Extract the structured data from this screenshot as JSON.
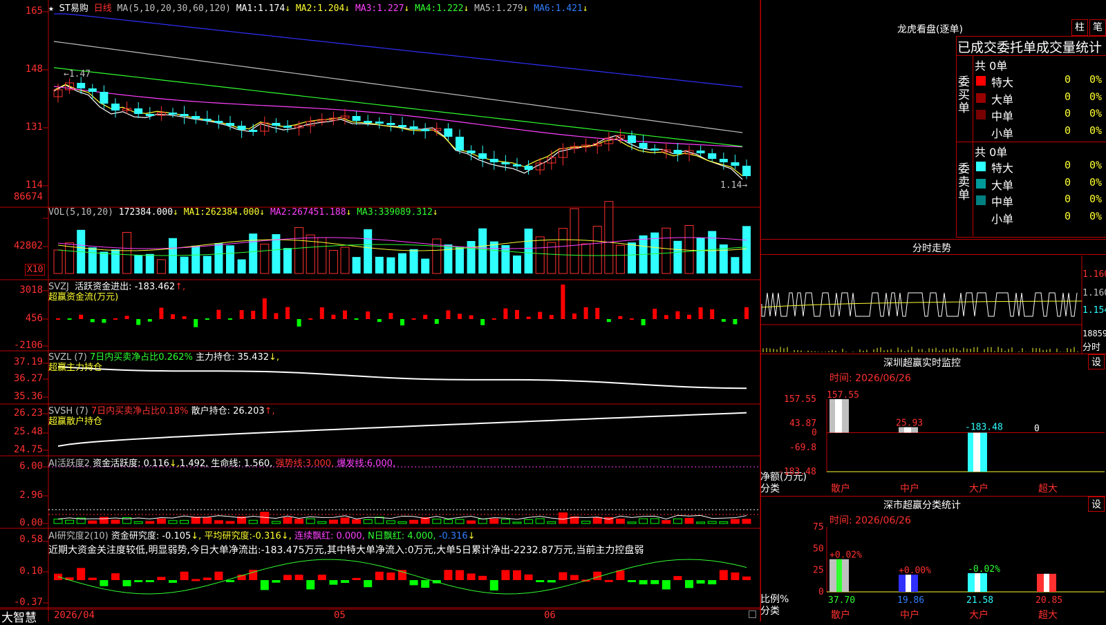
{
  "colors": {
    "up": "#ff3030",
    "down": "#30ffff",
    "grid": "#c00000",
    "ma1": "#ffffff",
    "ma2": "#ffff30",
    "ma3": "#ff40ff",
    "ma4": "#30ff30",
    "ma5": "#c0c0c0",
    "ma6": "#3030ff"
  },
  "price": {
    "title": "ST易购",
    "period": "日线",
    "ma_params": "MA(5,10,20,30,60,120)",
    "mas": [
      {
        "label": "MA1:",
        "value": "1.174",
        "arrow": "↓"
      },
      {
        "label": "MA2:",
        "value": "1.204",
        "arrow": "↓"
      },
      {
        "label": "MA3:",
        "value": "1.227",
        "arrow": "↓"
      },
      {
        "label": "MA4:",
        "value": "1.222",
        "arrow": "↓"
      },
      {
        "label": "MA5:",
        "value": "1.279",
        "arrow": "↓"
      },
      {
        "label": "MA6:",
        "value": "1.421",
        "arrow": "↓"
      }
    ],
    "axis": [
      "165",
      "148",
      "131",
      "114"
    ],
    "hi_label": "←1.47",
    "lo_label": "1.14→"
  },
  "volume": {
    "title": "VOL(5,10,20)",
    "value": "172384.000",
    "arrow": "↓",
    "mas": [
      {
        "label": "MA1:",
        "value": "262384.000",
        "arrow": "↓"
      },
      {
        "label": "MA2:",
        "value": "267451.188",
        "arrow": "↓"
      },
      {
        "label": "MA3:",
        "value": "339089.312",
        "arrow": "↓"
      }
    ],
    "axis": [
      "86674",
      "42802"
    ],
    "unit": "X10"
  },
  "svzj": {
    "title": "SVZJ",
    "text": "活跃资金进出:",
    "value": "-183.462",
    "arrow": "↑,",
    "sub": "超赢资金流(万元)",
    "axis": [
      "3018",
      "456",
      "-2106"
    ]
  },
  "svzl": {
    "title": "SVZL (7)",
    "t2": "7日内买卖净占比0.262%",
    "t3": "主力持仓:",
    "value": "35.432",
    "arrow": "↓,",
    "sub": "超赢主力持仓",
    "axis": [
      "37.19",
      "36.27",
      "35.36"
    ]
  },
  "svsh": {
    "title": "SVSH (7)",
    "t2": "7日内买卖净占比0.18%",
    "t3": "散户持仓:",
    "value": "26.203",
    "arrow": "↑,",
    "sub": "超赢散户持仓",
    "axis": [
      "26.23",
      "25.48",
      "24.75"
    ]
  },
  "ai1": {
    "title": "AI活跃度2",
    "t1": "资金活跃度:",
    "v1": "0.116",
    "a1": "↓,",
    "v2": "1.492,",
    "t3": "生命线:",
    "v3": "1.560,",
    "t4": "强势线:",
    "v4": "3.000,",
    "t5": "爆发线:",
    "v5": "6.000,",
    "axis": [
      "6.00",
      "2.96",
      "0.00"
    ]
  },
  "ai2": {
    "title": "AI研究度2(10)",
    "t1": "资金研究度:",
    "v1": "-0.105",
    "a1": "↓,",
    "t2": "平均研究度:",
    "v2": "-0.316",
    "a2": "↓,",
    "t3": "连续飘红:",
    "v3": "0.000,",
    "t4": "N日飘红:",
    "v4": "4.000,",
    "v5": "-0.316",
    "a5": "↓",
    "comment": "近期大资金关注度较低,明显弱势,今日大单净流出:-183.475万元,其中特大单净流入:0万元,大单5日累计净出-2232.87万元,当前主力控盘弱",
    "axis": [
      "0.58",
      "0.10",
      "-0.37"
    ]
  },
  "dates": [
    "2026/04",
    "05",
    "06"
  ],
  "brand": "大智慧",
  "lhb": {
    "title": "龙虎看盘(逐单)",
    "tab1": "柱",
    "tab2": "笔",
    "header": "已成交委托单成交量统计",
    "buy": {
      "side": "委买单",
      "total": "共 0单",
      "rows": [
        {
          "name": "特大",
          "v": "0",
          "p": "0%"
        },
        {
          "name": "大单",
          "v": "0",
          "p": "0%"
        },
        {
          "name": "中单",
          "v": "0",
          "p": "0%"
        },
        {
          "name": "小单",
          "v": "0",
          "p": "0%"
        }
      ]
    },
    "sell": {
      "side": "委卖单",
      "total": "共 0单",
      "rows": [
        {
          "name": "特大",
          "v": "0",
          "p": "0%"
        },
        {
          "name": "大单",
          "v": "0",
          "p": "0%"
        },
        {
          "name": "中单",
          "v": "0",
          "p": "0%"
        },
        {
          "name": "小单",
          "v": "0",
          "p": "0%"
        }
      ]
    }
  },
  "intraday": {
    "title": "分时走势",
    "axis": [
      "1.160",
      "1.160",
      "1.154",
      "18859",
      "分时"
    ]
  },
  "monitor": {
    "title": "深圳超赢实时监控",
    "btn": "设",
    "time": "时间: 2026/06/26",
    "axis": [
      "157.55",
      "43.87",
      "0",
      "-69.8",
      "-183.48"
    ],
    "bar_labels": [
      "157.55",
      "25.93",
      "-183.48",
      "0"
    ],
    "ylabel": "净额(万元)",
    "xlabel": "分类",
    "cats": [
      "散户",
      "中户",
      "大户",
      "超大"
    ]
  },
  "classify": {
    "title": "深市超赢分类统计",
    "btn": "设",
    "time": "时间: 2026/06/26",
    "axis": [
      "75",
      "50",
      "25",
      "0"
    ],
    "top_labels": [
      "+0.02%",
      "+0.00%",
      "-0.02%"
    ],
    "vals": [
      "37.70",
      "19.86",
      "21.58",
      "20.85"
    ],
    "ylabel": "比例%",
    "xlabel": "分类",
    "cats": [
      "散户",
      "中户",
      "大户",
      "超大"
    ]
  },
  "chart_data": [
    {
      "type": "bar",
      "title": "深圳超赢实时监控",
      "ylabel": "净额(万元)",
      "xlabel": "分类",
      "categories": [
        "散户",
        "中户",
        "大户",
        "超大"
      ],
      "values": [
        157.55,
        25.93,
        -183.48,
        0
      ],
      "ylim": [
        -183.48,
        157.55
      ]
    },
    {
      "type": "bar",
      "title": "深市超赢分类统计",
      "ylabel": "比例%",
      "xlabel": "分类",
      "categories": [
        "散户",
        "中户",
        "大户",
        "超大"
      ],
      "values": [
        37.7,
        19.86,
        21.58,
        20.85
      ],
      "ylim": [
        0,
        75
      ]
    }
  ]
}
